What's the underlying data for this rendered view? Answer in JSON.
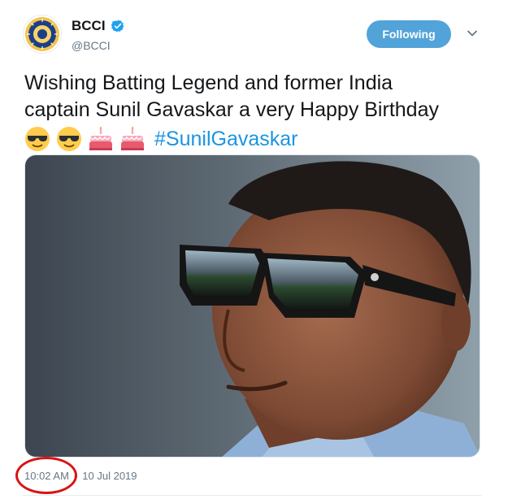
{
  "header": {
    "display_name": "BCCI",
    "handle": "@BCCI",
    "verified_icon": "verified-badge-icon",
    "follow_label": "Following",
    "caret_icon": "chevron-down-icon"
  },
  "tweet": {
    "line1": "Wishing Batting Legend and former India",
    "line2": "captain Sunil Gavaskar a very Happy Birthday",
    "emojis": [
      "sunglasses-emoji",
      "sunglasses-emoji",
      "birthday-cake-emoji",
      "birthday-cake-emoji"
    ],
    "hashtag": "#SunilGavaskar"
  },
  "media": {
    "photo": "portrait-photo"
  },
  "footer": {
    "time": "10:02 AM",
    "separator": "-",
    "date": "10 Jul 2019"
  },
  "colors": {
    "follow_button": "#52a3d9",
    "hashtag": "#1b95e0",
    "annotation_circle": "#d81313",
    "text": "#14171a",
    "muted": "#657786"
  }
}
